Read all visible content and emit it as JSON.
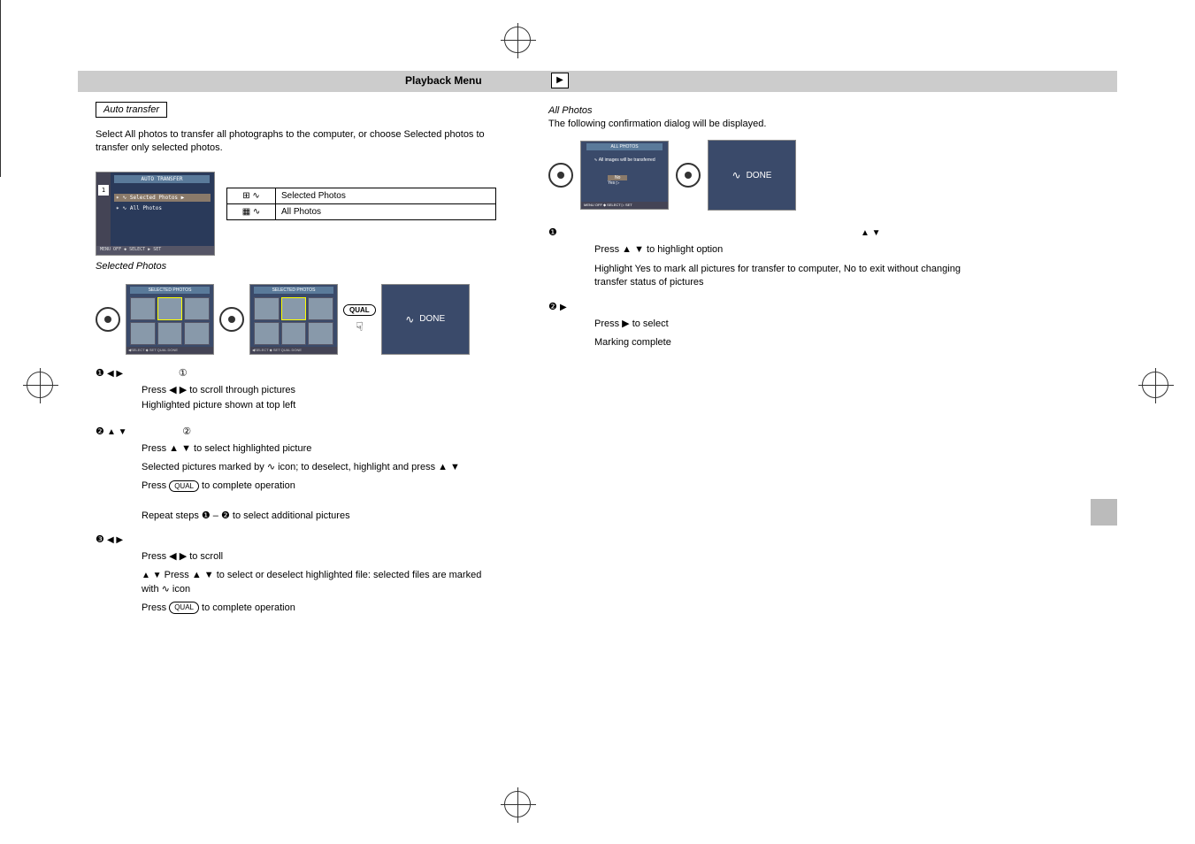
{
  "header": {
    "page_number": "",
    "title": "Playback Menu",
    "play_icon": "▶"
  },
  "left": {
    "section_title": "Auto transfer",
    "intro": "Select All photos to transfer all photographs to the computer, or choose Selected photos to transfer only selected photos.",
    "camera_menu": {
      "title": "AUTO TRANSFER",
      "sidebar_num": "1",
      "item_selected": "✶ ∿ Selected Photos ▶",
      "item_all": "✶ ∿ All Photos",
      "footer": "MENU OFF   ◆ SELECT   ▶ SET"
    },
    "table": {
      "row1_icon": "⊞ ∿",
      "row1_label": "Selected Photos",
      "row2_icon": "▦ ∿",
      "row2_label": "All Photos"
    },
    "selected_photos_header": "Selected Photos",
    "preview_title": "SELECTED PHOTOS",
    "preview_footer": "◀SELECT  ◆ SET  QUAL DONE",
    "qual_button": "QUAL",
    "done_label": "DONE",
    "steps_sel": {
      "s1l": "❶",
      "s1r": "①",
      "s1l_txt": "Press ◀ ▶ to scroll through pictures",
      "s1r_txt": "Highlighted picture shown at top left",
      "s2l": "❷",
      "s2r": "②",
      "s2l_txt": "Press ▲ ▼ to select highlighted picture",
      "s2r_txt": "Selected pictures marked by ∿ icon; to deselect, highlight and press ▲ ▼",
      "s2l_txt2": "Press   QUAL   to complete operation",
      "repeat_header": "Repeat steps ❶ – ❷ to select additional pictures",
      "s3l": "❸",
      "s3l_txt": "Press ◀ ▶ to scroll",
      "s3r": "Press ▲ ▼ to select or deselect highlighted file: selected files are marked with ∿ icon",
      "s3l_txt2": "Press   QUAL   to complete operation"
    }
  },
  "right": {
    "all_photos_header": "All Photos",
    "all_intro": "The following confirmation dialog will be displayed.",
    "confirm": {
      "title": "ALL PHOTOS",
      "msg": "∿ All images will be transferred",
      "opt_no": "No",
      "opt_yes": "Yes    ▷",
      "footer": "MENU OFF   ◆ SELECT   ▷ SET"
    },
    "done_label": "DONE",
    "steps_all": {
      "s1l": "❶",
      "s1l_txt": "Press ▲ ▼ to highlight option",
      "s1r": "Highlight Yes to mark all pictures for transfer to computer, No to exit without changing transfer status of pictures",
      "s2l": "❷",
      "s2l_txt": "Press ▶ to select",
      "s2r": "Marking complete"
    }
  },
  "sidebar_right": {
    "label1": "",
    "label2": ""
  }
}
